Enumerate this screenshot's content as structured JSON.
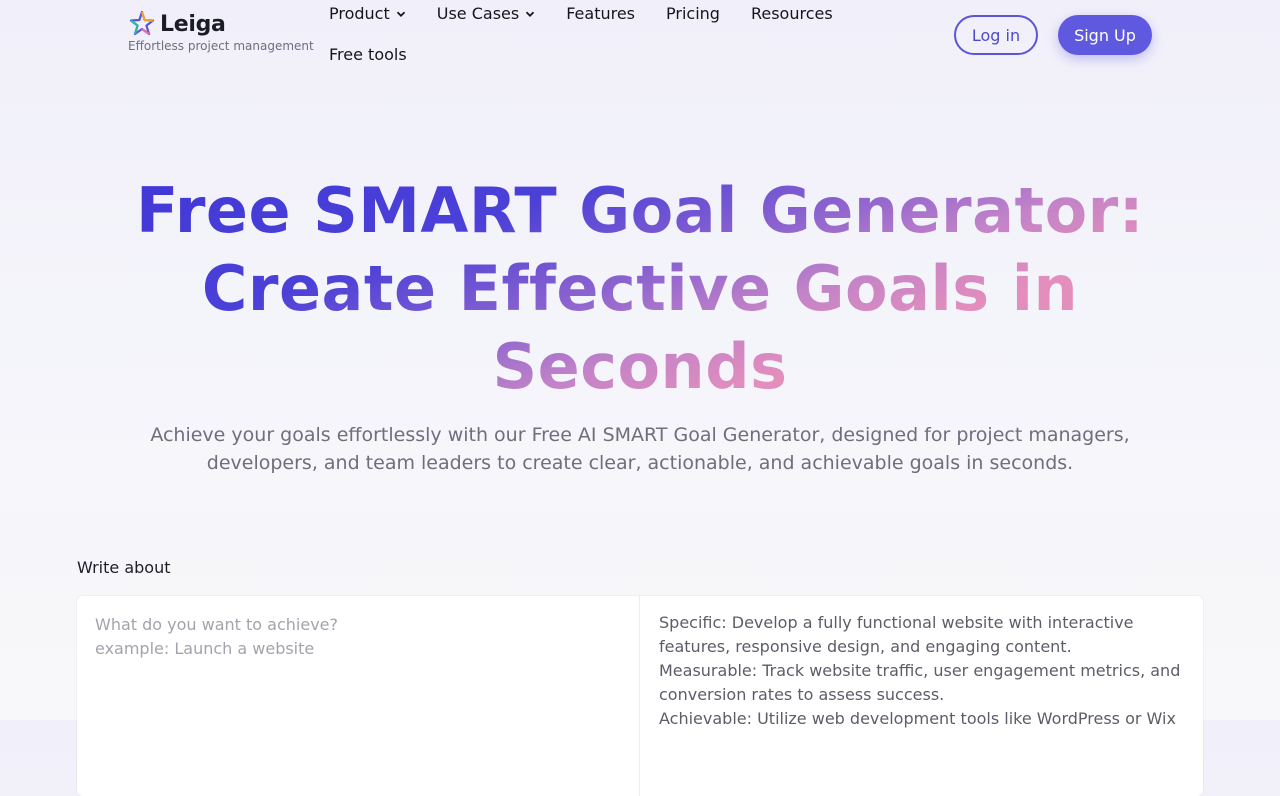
{
  "brand": {
    "name": "Leiga",
    "tagline": "Effortless project management"
  },
  "nav": {
    "items": [
      {
        "label": "Product",
        "has_dropdown": true
      },
      {
        "label": "Use Cases",
        "has_dropdown": true
      },
      {
        "label": "Features",
        "has_dropdown": false
      },
      {
        "label": "Pricing",
        "has_dropdown": false
      },
      {
        "label": "Resources",
        "has_dropdown": false
      },
      {
        "label": "Free tools",
        "has_dropdown": false
      }
    ],
    "login_label": "Log in",
    "signup_label": "Sign Up"
  },
  "hero": {
    "title_line1": "Free SMART Goal Generator:",
    "title_line2": "Create Effective Goals in",
    "title_line3": "Seconds",
    "subtitle": "Achieve your goals effortlessly with our Free AI SMART Goal Generator, designed for project managers, developers, and team leaders to create clear, actionable, and achievable goals in seconds."
  },
  "tool": {
    "label": "Write about",
    "input_placeholder": "What do you want to achieve?\nexample: Launch a website",
    "output": {
      "specific": "Specific: Develop a fully functional website with interactive features, responsive design, and engaging content.",
      "measurable": "Measurable: Track website traffic, user engagement metrics, and conversion rates to assess success.",
      "achievable": "Achievable: Utilize web development tools like WordPress or Wix"
    }
  },
  "colors": {
    "accent": "#5f59e0",
    "title_gradient_start": "#4137d6",
    "title_gradient_end": "#e494bd"
  }
}
